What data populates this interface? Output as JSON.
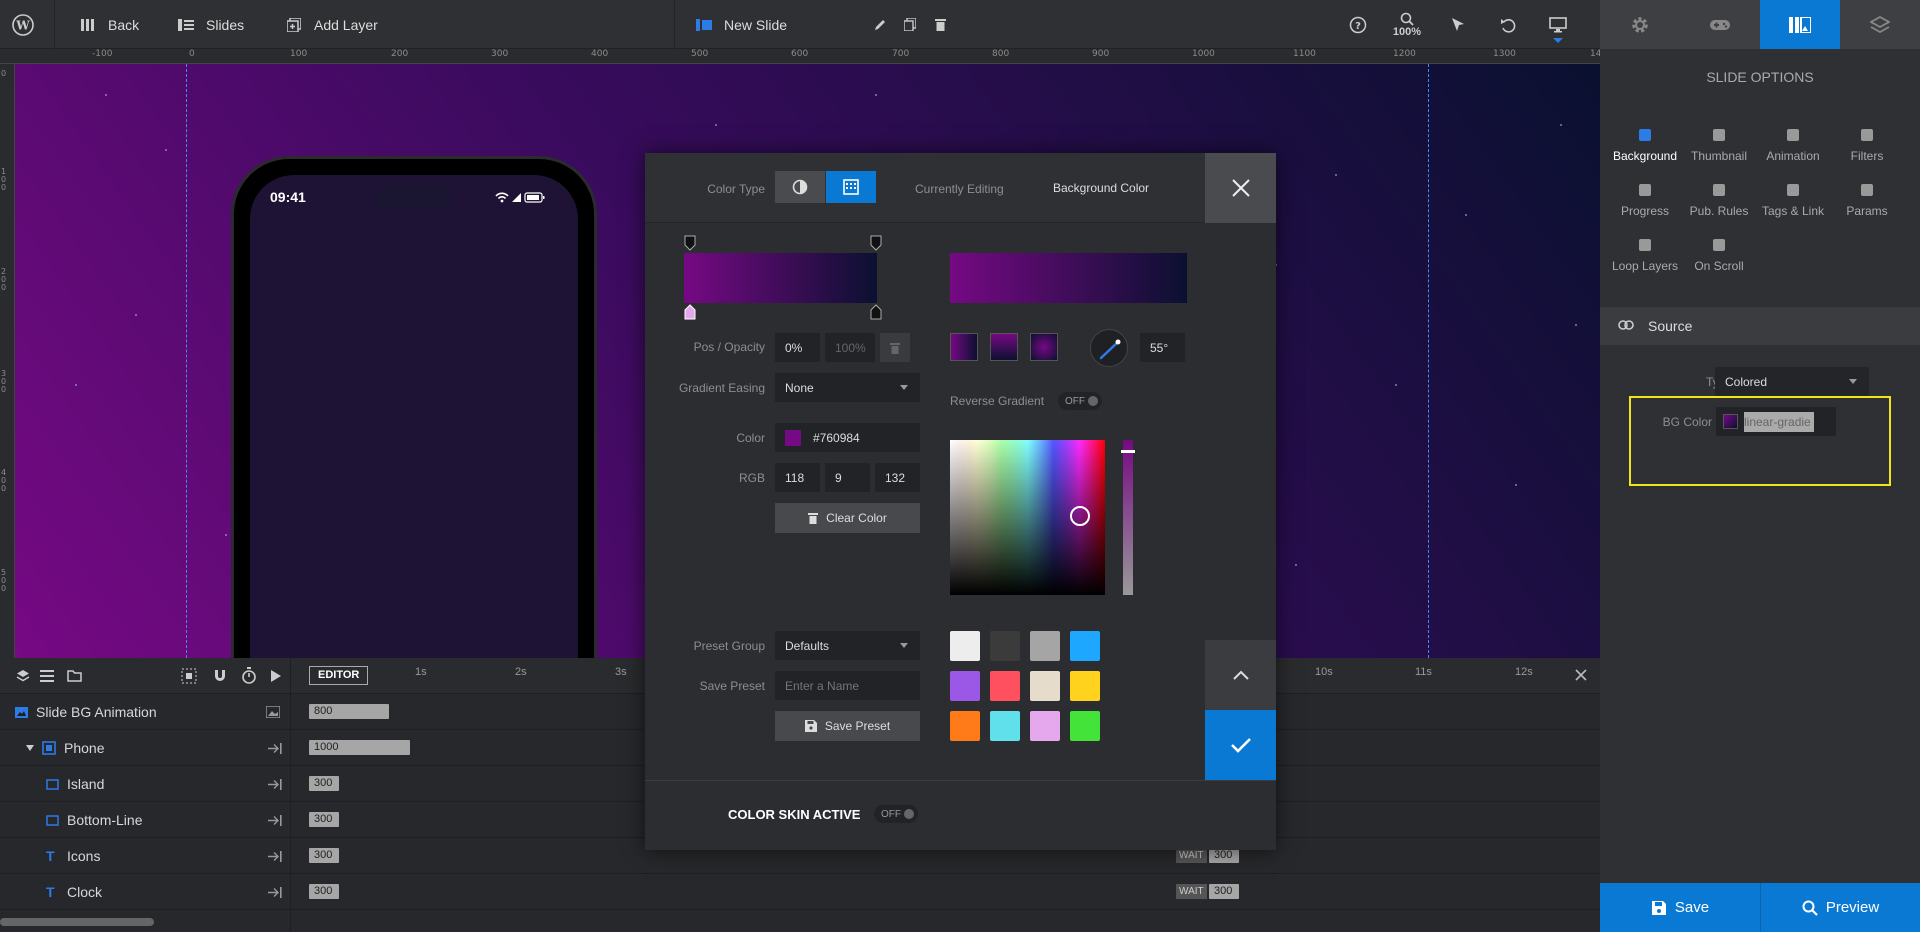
{
  "topbar": {
    "back_label": "Back",
    "slides_label": "Slides",
    "add_layer_label": "Add Layer",
    "slide_name": "New Slide",
    "zoom": "100%"
  },
  "ruler": {
    "h_ticks": [
      "-100",
      "0",
      "100",
      "200",
      "300",
      "400",
      "500",
      "600",
      "700",
      "800",
      "900",
      "1000",
      "1100",
      "1200",
      "1300",
      "14"
    ],
    "v_ticks": [
      "0",
      "100",
      "200",
      "300",
      "400",
      "500"
    ]
  },
  "phone": {
    "time": "09:41"
  },
  "timeline": {
    "editor_label": "EDITOR",
    "seconds_left": [
      "1s",
      "2s",
      "3s"
    ],
    "seconds_right": [
      "10s",
      "11s",
      "12s"
    ],
    "rows": [
      {
        "name": "Slide BG Animation",
        "bar": "800"
      },
      {
        "name": "Phone",
        "bar": "1000"
      },
      {
        "name": "Island",
        "bar": "300"
      },
      {
        "name": "Bottom-Line",
        "bar": "300"
      },
      {
        "name": "Icons",
        "bar": "300",
        "wait": "WAIT",
        "wait_val": "300"
      },
      {
        "name": "Clock",
        "bar": "300",
        "wait": "WAIT",
        "wait_val": "300"
      }
    ]
  },
  "sidebar": {
    "title": "SLIDE OPTIONS",
    "options": [
      "Background",
      "Thumbnail",
      "Animation",
      "Filters",
      "Progress",
      "Pub. Rules",
      "Tags & Link",
      "Params",
      "Loop Layers",
      "On Scroll"
    ],
    "source_title": "Source",
    "type_label": "Type",
    "type_value": "Colored",
    "bgcolor_label": "BG Color",
    "bgcolor_value": "linear-gradie",
    "save_label": "Save",
    "preview_label": "Preview"
  },
  "modal": {
    "color_type_label": "Color Type",
    "currently_editing_label": "Currently Editing",
    "currently_editing_value": "Background Color",
    "pos_opacity_label": "Pos / Opacity",
    "pos_value": "0%",
    "opacity_value": "100%",
    "gradient_easing_label": "Gradient Easing",
    "gradient_easing_value": "None",
    "color_label": "Color",
    "color_hex": "#760984",
    "rgb_label": "RGB",
    "r": "118",
    "g": "9",
    "b": "132",
    "clear_color_label": "Clear Color",
    "angle_value": "55°",
    "reverse_gradient_label": "Reverse Gradient",
    "reverse_toggle": "OFF",
    "preset_group_label": "Preset Group",
    "preset_group_value": "Defaults",
    "save_preset_label": "Save Preset",
    "save_preset_placeholder": "Enter a Name",
    "save_preset_button": "Save Preset",
    "color_skin_label": "COLOR SKIN ACTIVE",
    "color_skin_toggle": "OFF",
    "preset_swatches": [
      "#ededed",
      "#3b3b3b",
      "#a5a5a5",
      "#1ea7ff",
      "#9b58e6",
      "#ff5060",
      "#e6dccb",
      "#ffd21e",
      "#ff7b1a",
      "#5fe0ea",
      "#e5a8ec",
      "#44e33a"
    ],
    "gradient_start": "#760984",
    "gradient_end": "#0b1030"
  }
}
